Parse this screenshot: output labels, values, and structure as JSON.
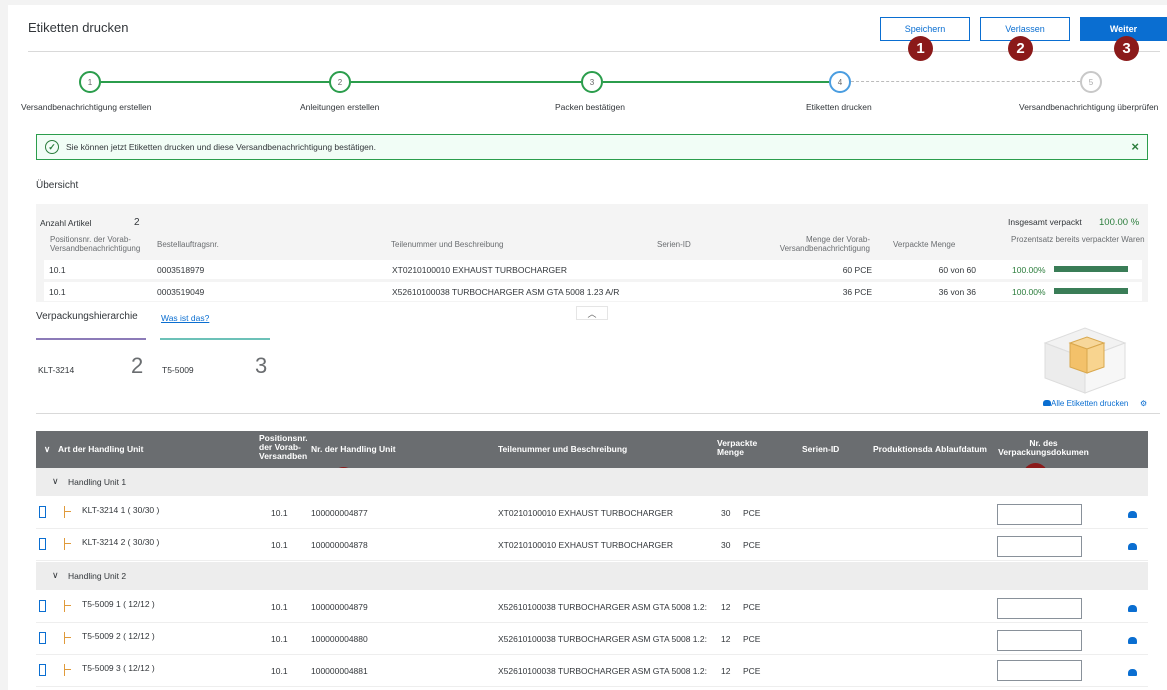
{
  "header": {
    "title": "Etiketten drucken",
    "save_label": "Speichern",
    "leave_label": "Verlassen",
    "next_label": "Weiter",
    "markers": [
      "1",
      "2",
      "3",
      "4",
      "5"
    ]
  },
  "steps": [
    {
      "num": "1",
      "label": "Versandbenachrichtigung erstellen",
      "state": "done"
    },
    {
      "num": "2",
      "label": "Anleitungen erstellen",
      "state": "done"
    },
    {
      "num": "3",
      "label": "Packen bestätigen",
      "state": "done"
    },
    {
      "num": "4",
      "label": "Etiketten drucken",
      "state": "current"
    },
    {
      "num": "5",
      "label": "Versandbenachrichtigung überprüfen",
      "state": "todo"
    }
  ],
  "message": {
    "text": "Sie können jetzt Etiketten drucken und diese Versandbenachrichtigung bestätigen.",
    "close": "×"
  },
  "overview": {
    "title": "Übersicht",
    "count_label": "Anzahl Artikel",
    "count_value": "2",
    "total_label": "Insgesamt verpackt",
    "total_value": "100.00 %",
    "columns": [
      "Positionsnr. der Vorab-Versandbenachrichtigung",
      "Bestellauftragsnr.",
      "Teilenummer und Beschreibung",
      "Serien-ID",
      "Menge der Vorab-Versandbenachrichtigung",
      "Verpackte Menge",
      "Prozentsatz bereits verpackter Waren"
    ],
    "rows": [
      {
        "pos": "10.1",
        "order": "0003518979",
        "part": "XT0210100010 EXHAUST TURBOCHARGER",
        "serial": "",
        "qty": "60 PCE",
        "packed": "60 von 60",
        "pct": "100.00%",
        "fill": 1.0
      },
      {
        "pos": "10.1",
        "order": "0003519049",
        "part": "X52610100038 TURBOCHARGER ASM GTA 5008 1.23 A/R",
        "serial": "",
        "qty": "36 PCE",
        "packed": "36 von 36",
        "pct": "100.00%",
        "fill": 1.0
      }
    ],
    "collapse_icon": "chevron-up"
  },
  "hierarchy": {
    "title": "Verpackungshierarchie",
    "link": "Was ist das?",
    "tiles": [
      {
        "name": "KLT-3214",
        "count": "2",
        "color": "#8c7bb8"
      },
      {
        "name": "T5-5009",
        "count": "3",
        "color": "#6cc1b8"
      }
    ],
    "print_all_label": "Alle Etiketten drucken"
  },
  "table": {
    "columns": {
      "type": "Art der Handling Unit",
      "pos": "Positionsnr. der Vorab-Versandben",
      "hu": "Nr. der Handling Unit",
      "part": "Teilenummer und Beschreibung",
      "packed": "Verpackte Menge",
      "serial": "Serien-ID",
      "prod": "Produktionsda",
      "exp": "Ablaufdatum",
      "doc": "Nr. des Verpackungsdokumen"
    },
    "groups": [
      {
        "label": "Handling Unit  1",
        "rows": [
          {
            "name": "KLT-3214 1 ( 30/30 )",
            "pos": "10.1",
            "hu": "100000004877",
            "part": "XT0210100010 EXHAUST TURBOCHARGER",
            "qty": "30",
            "unit": "PCE"
          },
          {
            "name": "KLT-3214 2 ( 30/30 )",
            "pos": "10.1",
            "hu": "100000004878",
            "part": "XT0210100010 EXHAUST TURBOCHARGER",
            "qty": "30",
            "unit": "PCE"
          }
        ]
      },
      {
        "label": "Handling Unit  2",
        "rows": [
          {
            "name": "T5-5009 1 ( 12/12 )",
            "pos": "10.1",
            "hu": "100000004879",
            "part": "X52610100038 TURBOCHARGER ASM GTA 5008 1.2:",
            "qty": "12",
            "unit": "PCE"
          },
          {
            "name": "T5-5009 2 ( 12/12 )",
            "pos": "10.1",
            "hu": "100000004880",
            "part": "X52610100038 TURBOCHARGER ASM GTA 5008 1.2:",
            "qty": "12",
            "unit": "PCE"
          },
          {
            "name": "T5-5009 3 ( 12/12 )",
            "pos": "10.1",
            "hu": "100000004881",
            "part": "X52610100038 TURBOCHARGER ASM GTA 5008 1.2:",
            "qty": "12",
            "unit": "PCE"
          }
        ]
      }
    ]
  }
}
